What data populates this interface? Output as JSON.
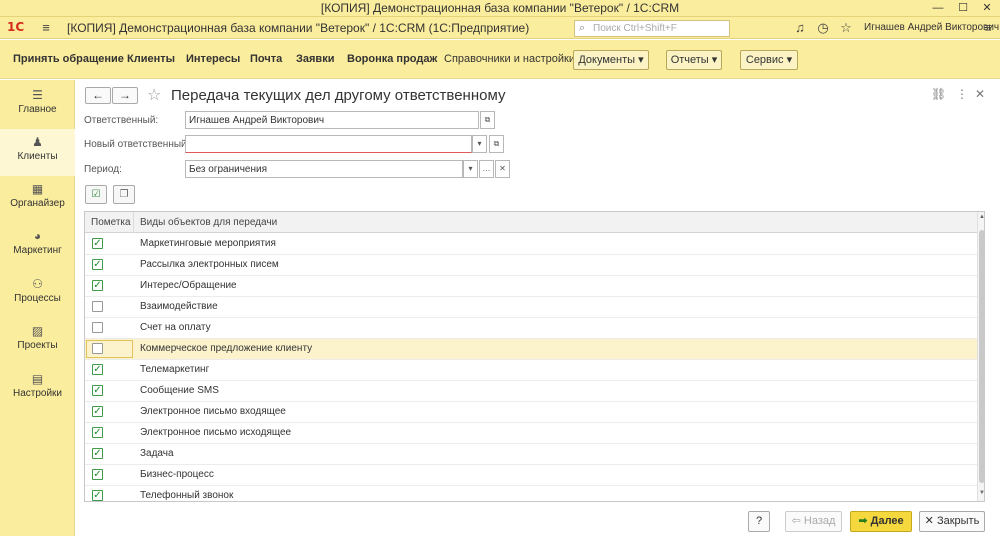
{
  "window": {
    "title": "[КОПИЯ] Демонстрационная база компании \"Ветерок\" / 1С:CRM",
    "controls": {
      "minimize": "—",
      "maximize": "☐",
      "close": "✕"
    }
  },
  "app_bar": {
    "logo": "1С",
    "title": "[КОПИЯ] Демонстрационная база компании \"Ветерок\" / 1С:CRM  (1С:Предприятие)",
    "search_placeholder": "Поиск Ctrl+Shift+F",
    "user": "Игнашев Андрей Викторович",
    "icons": [
      "grid-icon",
      "menu-icon",
      "home-icon",
      "search-icon",
      "bell-icon",
      "history-icon",
      "star-icon",
      "user-icon",
      "more-icon"
    ]
  },
  "sections": {
    "items": [
      "Принять обращение",
      "Клиенты",
      "Интересы",
      "Почта",
      "Заявки",
      "Воронка продаж",
      "Справочники и настройки"
    ],
    "buttons": [
      "Документы ▾",
      "Отчеты ▾",
      "Сервис ▾"
    ]
  },
  "sidebar": {
    "items": [
      {
        "label": "Главное",
        "icon": "menu-icon",
        "glyph": "☰"
      },
      {
        "label": "Клиенты",
        "icon": "clients-icon",
        "glyph": "♟"
      },
      {
        "label": "Органайзер",
        "icon": "calendar-icon",
        "glyph": "▦"
      },
      {
        "label": "Маркетинг",
        "icon": "pie-chart-icon",
        "glyph": "◕"
      },
      {
        "label": "Процессы",
        "icon": "process-icon",
        "glyph": "⚇"
      },
      {
        "label": "Проекты",
        "icon": "chart-icon",
        "glyph": "▨"
      },
      {
        "label": "Настройки",
        "icon": "settings-icon",
        "glyph": "▤"
      }
    ],
    "active": "Клиенты"
  },
  "form": {
    "title": "Передача текущих дел другому ответственному",
    "fields": {
      "responsible": {
        "label": "Ответственный:",
        "value": "Игнашев Андрей Викторович"
      },
      "new_responsible": {
        "label": "Новый ответственный:",
        "value": ""
      },
      "period": {
        "label": "Период:",
        "value": "Без ограничения"
      }
    },
    "table": {
      "columns": [
        "Пометка",
        "Виды объектов для передачи"
      ],
      "rows": [
        {
          "label": "Маркетинговые мероприятия",
          "checked": true
        },
        {
          "label": "Рассылка электронных писем",
          "checked": true
        },
        {
          "label": "Интерес/Обращение",
          "checked": true
        },
        {
          "label": "Взаимодействие",
          "checked": false
        },
        {
          "label": "Счет на оплату",
          "checked": false
        },
        {
          "label": "Коммерческое предложение клиенту",
          "checked": false,
          "selected": true
        },
        {
          "label": "Телемаркетинг",
          "checked": true
        },
        {
          "label": "Сообщение SMS",
          "checked": true
        },
        {
          "label": "Электронное письмо входящее",
          "checked": true
        },
        {
          "label": "Электронное письмо исходящее",
          "checked": true
        },
        {
          "label": "Задача",
          "checked": true
        },
        {
          "label": "Бизнес-процесс",
          "checked": true
        },
        {
          "label": "Телефонный звонок",
          "checked": true
        }
      ]
    },
    "buttons": {
      "help": "?",
      "back": "Назад",
      "next": "Далее",
      "close": "Закрыть"
    }
  },
  "colors": {
    "chrome": "#fbed9e",
    "accent": "#f5d83e",
    "check": "#1f8b2c",
    "selected_row": "#fcf3cd"
  }
}
